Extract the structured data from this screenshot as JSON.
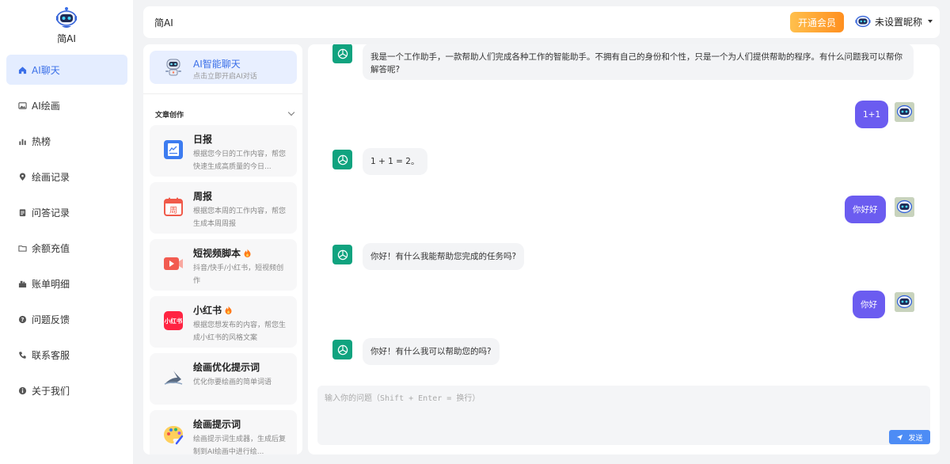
{
  "brand": {
    "name": "简AI"
  },
  "nav": {
    "items": [
      {
        "label": "AI聊天",
        "icon": "home-icon",
        "active": true
      },
      {
        "label": "AI绘画",
        "icon": "image-icon"
      },
      {
        "label": "热榜",
        "icon": "bar-chart-icon"
      },
      {
        "label": "绘画记录",
        "icon": "location-pin-icon"
      },
      {
        "label": "问答记录",
        "icon": "clipboard-icon"
      },
      {
        "label": "余额充值",
        "icon": "folder-icon"
      },
      {
        "label": "账单明细",
        "icon": "bill-icon"
      },
      {
        "label": "问题反馈",
        "icon": "question-icon"
      },
      {
        "label": "联系客服",
        "icon": "phone-icon"
      },
      {
        "label": "关于我们",
        "icon": "info-icon"
      }
    ]
  },
  "topbar": {
    "title": "简AI",
    "vip_label": "开通会员",
    "username": "未设置昵称"
  },
  "apps_panel": {
    "chat_entry": {
      "title": "AI智能聊天",
      "subtitle": "点击立即开启AI对话"
    },
    "section_title": "文章创作",
    "cards": [
      {
        "title": "日报",
        "desc": "根据您今日的工作内容，帮您快速生成高质量的今日...",
        "icon": "daily-report-icon",
        "hot": false
      },
      {
        "title": "周报",
        "desc": "根据您本周的工作内容，帮您生成本周周报",
        "icon": "weekly-calendar-icon",
        "hot": false
      },
      {
        "title": "短视频脚本",
        "desc": "抖音/快手/小红书，短视频创作",
        "icon": "video-icon",
        "hot": true
      },
      {
        "title": "小红书",
        "desc": "根据您想发布的内容，帮您生成小红书的风格文案",
        "icon": "xiaohongshu-icon",
        "icon_text": "小红书",
        "hot": true
      },
      {
        "title": "绘画优化提示词",
        "desc": "优化你要绘画的简单词语",
        "icon": "shark-icon",
        "hot": false
      },
      {
        "title": "绘画提示词",
        "desc": "绘画提示词生成器，生成后复制到AI绘画中进行绘...",
        "icon": "palette-icon",
        "hot": false
      }
    ]
  },
  "chat": {
    "messages": [
      {
        "role": "ai",
        "text": "我是一个工作助手，一款帮助人们完成各种工作的智能助手。不拥有自己的身份和个性，只是一个为人们提供帮助的程序。有什么问题我可以帮你解答呢?"
      },
      {
        "role": "user",
        "text": "1+1"
      },
      {
        "role": "ai",
        "text": "1 + 1 = 2。"
      },
      {
        "role": "user",
        "text": "你好好"
      },
      {
        "role": "ai",
        "text": "你好！有什么我能帮助您完成的任务吗?"
      },
      {
        "role": "user",
        "text": "你好"
      },
      {
        "role": "ai",
        "text": "你好！有什么我可以帮助您的吗?"
      }
    ],
    "input_placeholder": "输入你的问题（Shift + Enter = 换行）",
    "send_label": "发送"
  },
  "colors": {
    "accent": "#3a6fe8",
    "user_bubble": "#6b5cf0",
    "gpt_green": "#10a37f",
    "vip_gradient_start": "#ffc04d",
    "vip_gradient_end": "#ff8f1f",
    "send_button": "#4d8cf5"
  }
}
